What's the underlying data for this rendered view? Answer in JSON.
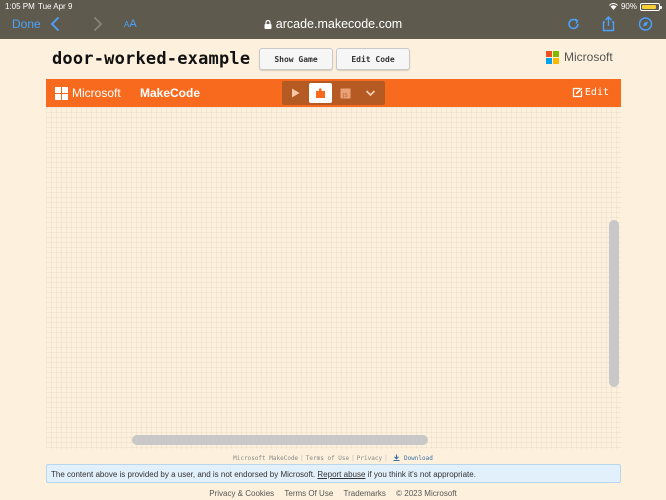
{
  "status_bar": {
    "time": "1:05 PM",
    "date": "Tue Apr 9",
    "battery": "90%",
    "battery_level": 0.9
  },
  "browser": {
    "done_label": "Done",
    "text_size_label_small": "A",
    "text_size_label_big": "A",
    "url": "arcade.makecode.com"
  },
  "page": {
    "project_title": "door-worked-example",
    "show_game_label": "Show Game",
    "edit_code_label": "Edit Code",
    "brand_label": "Microsoft"
  },
  "makecode_bar": {
    "brand_label": "Microsoft",
    "product_label": "MakeCode",
    "edit_label": "Edit",
    "views": [
      "play",
      "blocks",
      "javascript",
      "more"
    ],
    "active_view": "blocks"
  },
  "footer": {
    "links": [
      "Microsoft MakeCode",
      "Terms of Use",
      "Privacy"
    ],
    "download_label": "Download"
  },
  "notice": {
    "before": "The content above is provided by a user, and is not endorsed by Microsoft.",
    "link": "Report abuse",
    "after": "if you think it's not appropriate."
  },
  "bottom_links": [
    "Privacy & Cookies",
    "Terms Of Use",
    "Trademarks",
    "© 2023 Microsoft"
  ],
  "colors": {
    "makecode_orange": "#f86b1f",
    "safari_blue": "#4aa3ff",
    "ms_red": "#f25022",
    "ms_green": "#7fba00",
    "ms_blue": "#00a4ef",
    "ms_yellow": "#ffb900"
  }
}
